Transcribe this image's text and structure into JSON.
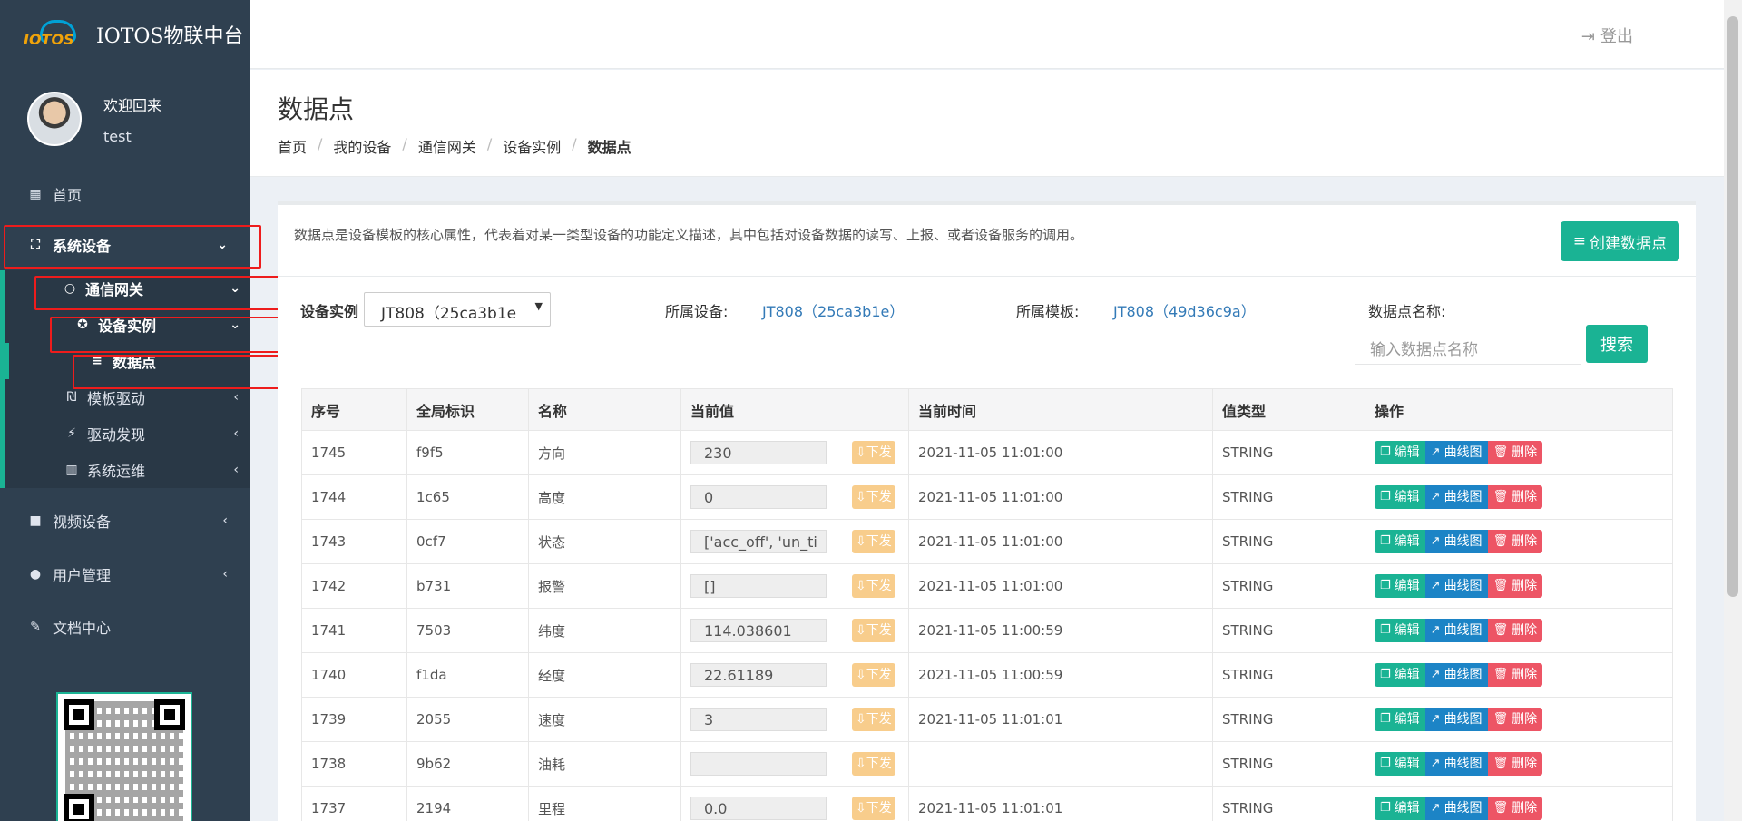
{
  "app": {
    "title": "IOTOS物联中台",
    "logo_text": "IOTOS"
  },
  "user": {
    "welcome": "欢迎回来",
    "name": "test"
  },
  "sidebar": {
    "items": [
      {
        "label": "首页",
        "icon": "dashboard-icon"
      },
      {
        "label": "系统设备",
        "icon": "sitemap-icon"
      },
      {
        "label": "视频设备",
        "icon": "video-icon"
      },
      {
        "label": "用户管理",
        "icon": "user-icon"
      },
      {
        "label": "文档中心",
        "icon": "edit-icon"
      }
    ],
    "sub": {
      "gateway": "通信网关",
      "instance": "设备实例",
      "datapoint": "数据点",
      "template": "模板驱动",
      "discover": "驱动发现",
      "ops": "系统运维"
    }
  },
  "topbar": {
    "logout": "登出"
  },
  "page": {
    "title": "数据点",
    "breadcrumb": [
      "首页",
      "我的设备",
      "通信网关",
      "设备实例",
      "数据点"
    ],
    "description": "数据点是设备模板的核心属性，代表着对某一类型设备的功能定义描述，其中包括对设备数据的读写、上报、或者设备服务的调用。",
    "create_button": "创建数据点"
  },
  "filters": {
    "instance_label": "设备实例",
    "instance_value": "JT808（25ca3b1e",
    "device_label": "所属设备:",
    "device_value": "JT808（25ca3b1e）",
    "template_label": "所属模板:",
    "template_value": "JT808（49d36c9a）",
    "name_label": "数据点名称:",
    "name_placeholder": "输入数据点名称",
    "search_button": "搜索"
  },
  "table": {
    "headers": [
      "序号",
      "全局标识",
      "名称",
      "当前值",
      "当前时间",
      "值类型",
      "操作"
    ],
    "send_label": "下发",
    "ops": {
      "edit": "编辑",
      "curve": "曲线图",
      "delete": "删除"
    },
    "rows": [
      {
        "id": "1745",
        "gid": "f9f5",
        "name": "方向",
        "value": "230",
        "time": "2021-11-05 11:01:00",
        "type": "STRING"
      },
      {
        "id": "1744",
        "gid": "1c65",
        "name": "高度",
        "value": "0",
        "time": "2021-11-05 11:01:00",
        "type": "STRING"
      },
      {
        "id": "1743",
        "gid": "0cf7",
        "name": "状态",
        "value": "['acc_off', 'un_ti",
        "time": "2021-11-05 11:01:00",
        "type": "STRING"
      },
      {
        "id": "1742",
        "gid": "b731",
        "name": "报警",
        "value": "[]",
        "time": "2021-11-05 11:01:00",
        "type": "STRING"
      },
      {
        "id": "1741",
        "gid": "7503",
        "name": "纬度",
        "value": "114.038601",
        "time": "2021-11-05 11:00:59",
        "type": "STRING"
      },
      {
        "id": "1740",
        "gid": "f1da",
        "name": "经度",
        "value": "22.61189",
        "time": "2021-11-05 11:00:59",
        "type": "STRING"
      },
      {
        "id": "1739",
        "gid": "2055",
        "name": "速度",
        "value": "3",
        "time": "2021-11-05 11:01:01",
        "type": "STRING"
      },
      {
        "id": "1738",
        "gid": "9b62",
        "name": "油耗",
        "value": "",
        "time": "",
        "type": "STRING"
      },
      {
        "id": "1737",
        "gid": "2194",
        "name": "里程",
        "value": "0.0",
        "time": "2021-11-05 11:01:01",
        "type": "STRING"
      }
    ]
  },
  "colors": {
    "sidebar": "#2f4050",
    "accent": "#1ab394",
    "primary": "#1c84c6",
    "danger": "#ed5565",
    "warning": "#f8cd8c",
    "highlight": "#ee1c1c"
  }
}
